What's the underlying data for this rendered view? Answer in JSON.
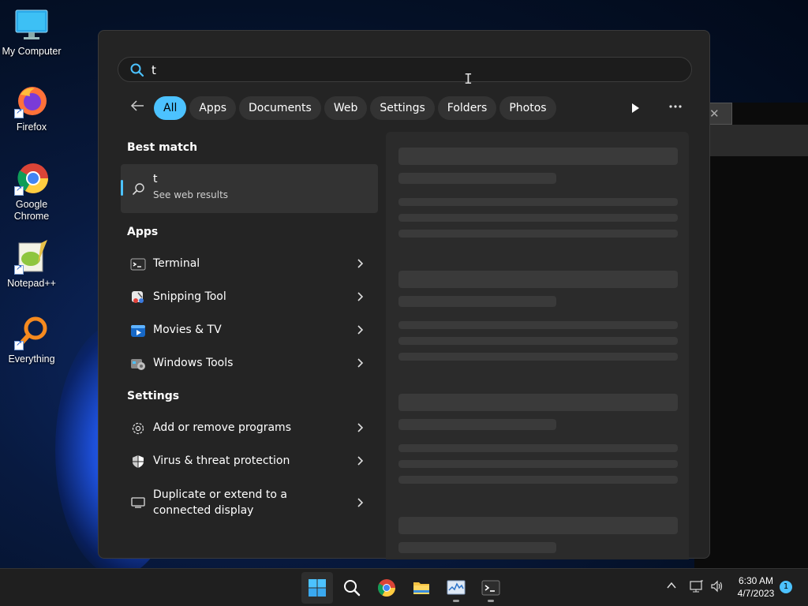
{
  "desktop": {
    "icons": [
      {
        "label": "My Computer"
      },
      {
        "label": "Firefox"
      },
      {
        "label": "Google Chrome"
      },
      {
        "label": "Notepad++"
      },
      {
        "label": "Everything"
      }
    ]
  },
  "search": {
    "query": "t",
    "filters": [
      "All",
      "Apps",
      "Documents",
      "Web",
      "Settings",
      "Folders",
      "Photos"
    ],
    "active_filter": "All"
  },
  "results": {
    "best_match_heading": "Best match",
    "best_match": {
      "title": "t",
      "subtitle": "See web results"
    },
    "apps_heading": "Apps",
    "apps": [
      {
        "label": "Terminal",
        "icon": "terminal-icon"
      },
      {
        "label": "Snipping Tool",
        "icon": "snipping-tool-icon"
      },
      {
        "label": "Movies & TV",
        "icon": "movies-tv-icon"
      },
      {
        "label": "Windows Tools",
        "icon": "windows-tools-icon"
      }
    ],
    "settings_heading": "Settings",
    "settings": [
      {
        "label": "Add or remove programs",
        "icon": "gear-icon"
      },
      {
        "label": "Virus & threat protection",
        "icon": "shield-icon"
      },
      {
        "label": "Duplicate or extend to a connected display",
        "icon": "display-icon"
      }
    ]
  },
  "taskbar": {
    "clock_time": "6:30 AM",
    "clock_date": "4/7/2023",
    "notification_count": "1"
  },
  "colors": {
    "accent": "#4cc2ff",
    "panel": "#242424",
    "taskbar": "#1f1f1f"
  }
}
